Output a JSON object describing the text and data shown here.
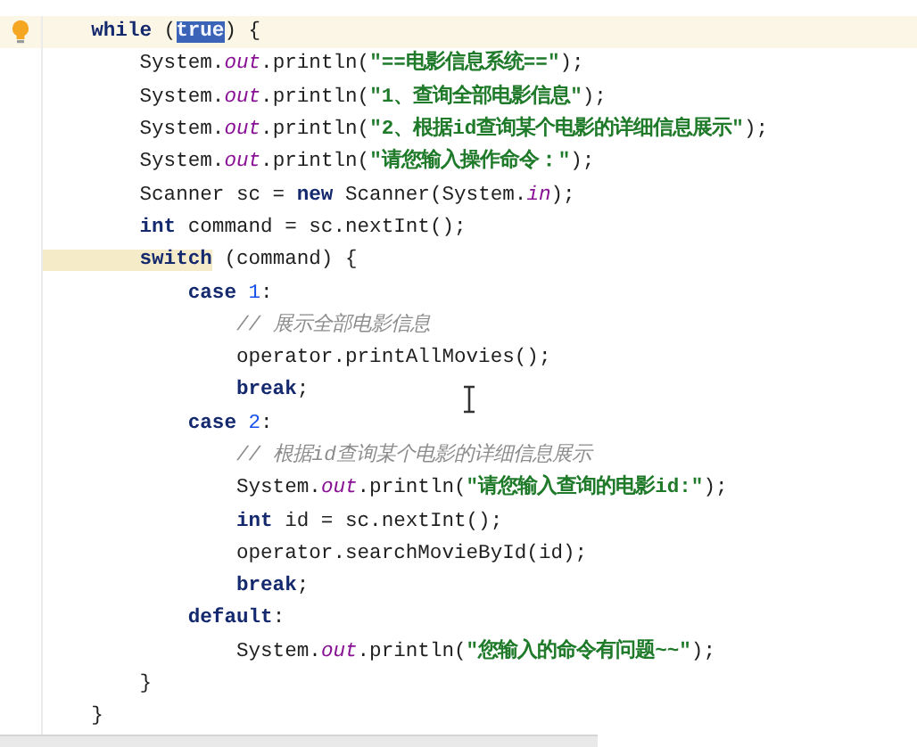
{
  "editor": {
    "lines": [
      {
        "current": true,
        "bulb": true,
        "tokens": [
          {
            "kind": "keyword",
            "text": "    while"
          },
          {
            "kind": "plain",
            "text": " ("
          },
          {
            "kind": "keyword",
            "text": "true",
            "selected": true
          },
          {
            "kind": "plain",
            "text": ") {"
          }
        ]
      },
      {
        "current": false,
        "bulb": false,
        "tokens": [
          {
            "kind": "plain",
            "text": "        System."
          },
          {
            "kind": "field",
            "text": "out"
          },
          {
            "kind": "plain",
            "text": ".println("
          },
          {
            "kind": "string",
            "text": "\"==电影信息系统==\""
          },
          {
            "kind": "plain",
            "text": ");"
          }
        ]
      },
      {
        "current": false,
        "bulb": false,
        "tokens": [
          {
            "kind": "plain",
            "text": "        System."
          },
          {
            "kind": "field",
            "text": "out"
          },
          {
            "kind": "plain",
            "text": ".println("
          },
          {
            "kind": "string",
            "text": "\"1、查询全部电影信息\""
          },
          {
            "kind": "plain",
            "text": ");"
          }
        ]
      },
      {
        "current": false,
        "bulb": false,
        "tokens": [
          {
            "kind": "plain",
            "text": "        System."
          },
          {
            "kind": "field",
            "text": "out"
          },
          {
            "kind": "plain",
            "text": ".println("
          },
          {
            "kind": "string",
            "text": "\"2、根据id查询某个电影的详细信息展示\""
          },
          {
            "kind": "plain",
            "text": ");"
          }
        ]
      },
      {
        "current": false,
        "bulb": false,
        "tokens": [
          {
            "kind": "plain",
            "text": "        System."
          },
          {
            "kind": "field",
            "text": "out"
          },
          {
            "kind": "plain",
            "text": ".println("
          },
          {
            "kind": "string",
            "text": "\"请您输入操作命令：\""
          },
          {
            "kind": "plain",
            "text": ");"
          }
        ]
      },
      {
        "current": false,
        "bulb": false,
        "tokens": [
          {
            "kind": "plain",
            "text": "        Scanner sc = "
          },
          {
            "kind": "keyword",
            "text": "new"
          },
          {
            "kind": "plain",
            "text": " Scanner(System."
          },
          {
            "kind": "field",
            "text": "in"
          },
          {
            "kind": "plain",
            "text": ");"
          }
        ]
      },
      {
        "current": false,
        "bulb": false,
        "tokens": [
          {
            "kind": "keyword",
            "text": "        int"
          },
          {
            "kind": "plain",
            "text": " command = sc.nextInt();"
          }
        ]
      },
      {
        "current": false,
        "bulb": false,
        "tokens": [
          {
            "kind": "keyword",
            "text": "        switch",
            "matched": true
          },
          {
            "kind": "plain",
            "text": " (command) {"
          }
        ]
      },
      {
        "current": false,
        "bulb": false,
        "tokens": [
          {
            "kind": "keyword",
            "text": "            case "
          },
          {
            "kind": "number",
            "text": "1"
          },
          {
            "kind": "plain",
            "text": ":"
          }
        ]
      },
      {
        "current": false,
        "bulb": false,
        "tokens": [
          {
            "kind": "comment",
            "text": "                // 展示全部电影信息"
          }
        ]
      },
      {
        "current": false,
        "bulb": false,
        "tokens": [
          {
            "kind": "plain",
            "text": "                operator.printAllMovies();"
          }
        ]
      },
      {
        "current": false,
        "bulb": false,
        "tokens": [
          {
            "kind": "keyword",
            "text": "                break"
          },
          {
            "kind": "plain",
            "text": ";"
          }
        ]
      },
      {
        "current": false,
        "bulb": false,
        "tokens": [
          {
            "kind": "keyword",
            "text": "            case "
          },
          {
            "kind": "number",
            "text": "2"
          },
          {
            "kind": "plain",
            "text": ":"
          }
        ]
      },
      {
        "current": false,
        "bulb": false,
        "tokens": [
          {
            "kind": "comment",
            "text": "                // 根据id查询某个电影的详细信息展示"
          }
        ]
      },
      {
        "current": false,
        "bulb": false,
        "tokens": [
          {
            "kind": "plain",
            "text": "                System."
          },
          {
            "kind": "field",
            "text": "out"
          },
          {
            "kind": "plain",
            "text": ".println("
          },
          {
            "kind": "string",
            "text": "\"请您输入查询的电影id:\""
          },
          {
            "kind": "plain",
            "text": ");"
          }
        ]
      },
      {
        "current": false,
        "bulb": false,
        "tokens": [
          {
            "kind": "keyword",
            "text": "                int"
          },
          {
            "kind": "plain",
            "text": " id = sc.nextInt();"
          }
        ]
      },
      {
        "current": false,
        "bulb": false,
        "tokens": [
          {
            "kind": "plain",
            "text": "                operator.searchMovieById(id);"
          }
        ]
      },
      {
        "current": false,
        "bulb": false,
        "tokens": [
          {
            "kind": "keyword",
            "text": "                break"
          },
          {
            "kind": "plain",
            "text": ";"
          }
        ]
      },
      {
        "current": false,
        "bulb": false,
        "tokens": [
          {
            "kind": "keyword",
            "text": "            default"
          },
          {
            "kind": "plain",
            "text": ":"
          }
        ]
      },
      {
        "current": false,
        "bulb": false,
        "tokens": [
          {
            "kind": "plain",
            "text": "                System."
          },
          {
            "kind": "field",
            "text": "out"
          },
          {
            "kind": "plain",
            "text": ".println("
          },
          {
            "kind": "string",
            "text": "\"您输入的命令有问题~~\""
          },
          {
            "kind": "plain",
            "text": ");"
          }
        ]
      },
      {
        "current": false,
        "bulb": false,
        "tokens": [
          {
            "kind": "plain",
            "text": "        }"
          }
        ]
      },
      {
        "current": false,
        "bulb": false,
        "tokens": [
          {
            "kind": "plain",
            "text": "    }"
          }
        ]
      }
    ]
  }
}
